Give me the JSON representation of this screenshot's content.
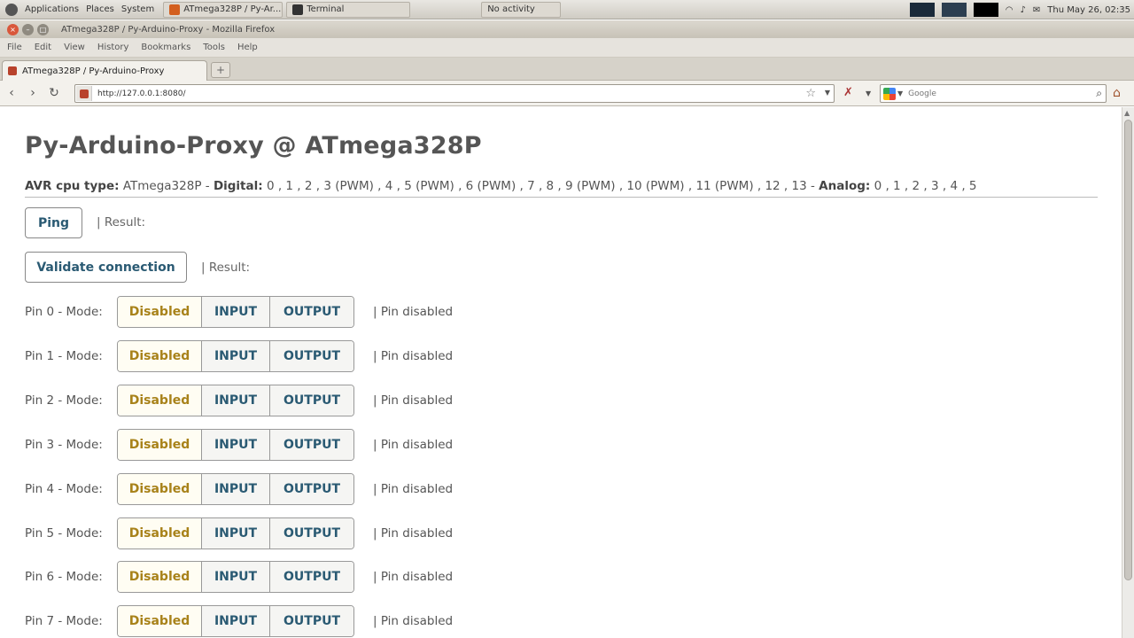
{
  "system_panel": {
    "menus": [
      "Applications",
      "Places",
      "System"
    ],
    "tasks": [
      "ATmega328P / Py-Ar...",
      "Terminal",
      "No activity"
    ],
    "clock": "Thu May 26, 02:35"
  },
  "window": {
    "title": "ATmega328P / Py-Arduino-Proxy - Mozilla Firefox"
  },
  "menubar": {
    "items": [
      "File",
      "Edit",
      "View",
      "History",
      "Bookmarks",
      "Tools",
      "Help"
    ]
  },
  "tab": {
    "label": "ATmega328P / Py-Arduino-Proxy",
    "new_tab": "+"
  },
  "nav": {
    "url": "http://127.0.0.1:8080/",
    "search_placeholder": "Google"
  },
  "page": {
    "title": "Py-Arduino-Proxy @ ATmega328P",
    "cpu_label": "AVR cpu type:",
    "cpu_value": "ATmega328P -",
    "digital_label": "Digital:",
    "digital_value": "0 , 1 , 2 , 3 (PWM) , 4 , 5 (PWM) , 6 (PWM) , 7 , 8 , 9 (PWM) , 10 (PWM) , 11 (PWM) , 12 , 13 -",
    "analog_label": "Analog:",
    "analog_value": "0 , 1 , 2 , 3 , 4 , 5",
    "ping_button": "Ping",
    "ping_result": "| Result:",
    "validate_button": "Validate connection",
    "validate_result": "| Result:",
    "mode_disabled": "Disabled",
    "mode_input": "INPUT",
    "mode_output": "OUTPUT",
    "pins": [
      {
        "label": "Pin 0 - Mode:",
        "status": "| Pin disabled"
      },
      {
        "label": "Pin 1 - Mode:",
        "status": "| Pin disabled"
      },
      {
        "label": "Pin 2 - Mode:",
        "status": "| Pin disabled"
      },
      {
        "label": "Pin 3 - Mode:",
        "status": "| Pin disabled"
      },
      {
        "label": "Pin 4 - Mode:",
        "status": "| Pin disabled"
      },
      {
        "label": "Pin 5 - Mode:",
        "status": "| Pin disabled"
      },
      {
        "label": "Pin 6 - Mode:",
        "status": "| Pin disabled"
      },
      {
        "label": "Pin 7 - Mode:",
        "status": "| Pin disabled"
      }
    ]
  },
  "colors": {
    "button_text": "#2a5a73",
    "disabled_text": "#a8821a",
    "body_text": "#555555"
  }
}
